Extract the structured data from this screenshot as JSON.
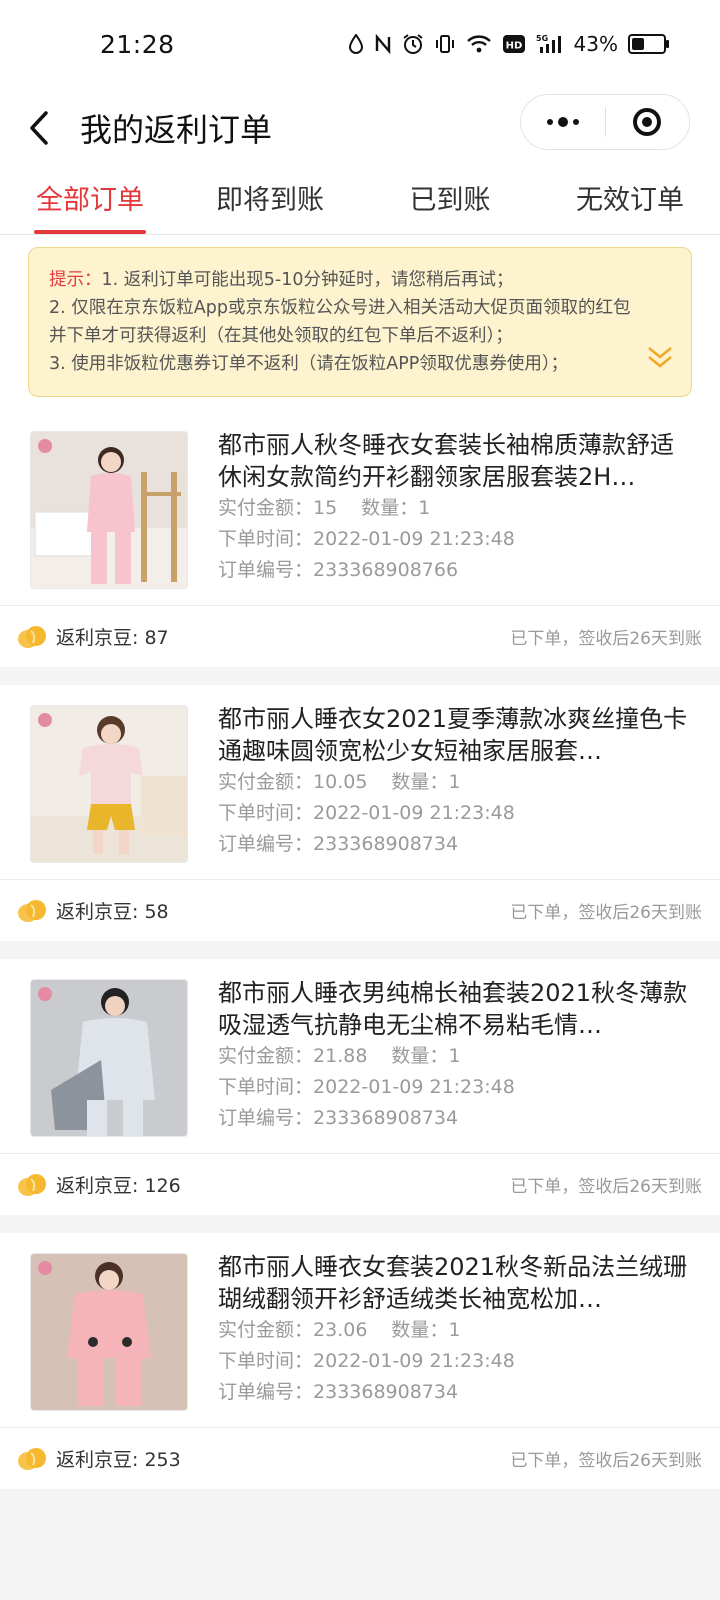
{
  "status_bar": {
    "time": "21:28",
    "icons": [
      "water-drop-icon",
      "nfc-icon",
      "alarm-icon",
      "vibrate-icon",
      "wifi-icon",
      "hd-icon",
      "signal-5g-icon"
    ],
    "battery_text": "43%",
    "battery_level": 0.43
  },
  "nav": {
    "title": "我的返利订单"
  },
  "tabs": [
    {
      "label": "全部订单",
      "active": true
    },
    {
      "label": "即将到账",
      "active": false
    },
    {
      "label": "已到账",
      "active": false
    },
    {
      "label": "无效订单",
      "active": false
    }
  ],
  "notice": {
    "hint_label": "提示：",
    "line1": "1. 返利订单可能出现5-10分钟延时，请您稍后再试；",
    "line2": "2. 仅限在京东饭粒App或京东饭粒公众号进入相关活动大促页面领取的红包并下单才可获得返利（在其他处领取的红包下单后不返利）；",
    "line3": "3. 使用非饭粒优惠券订单不返利（请在饭粒APP领取优惠券使用）；"
  },
  "labels": {
    "paid": "实付金额：",
    "qty": "数量：",
    "time": "下单时间：",
    "order_no": "订单编号："
  },
  "orders": [
    {
      "title": "都市丽人秋冬睡衣女套装长袖棉质薄款舒适休闲女款简约开衫翻领家居服套装2H…",
      "paid": "15",
      "qty": "1",
      "time": "2022-01-09 21:23:48",
      "order_no": "233368908766",
      "bean": "返利京豆: 87",
      "status": "已下单，签收后26天到账"
    },
    {
      "title": "都市丽人睡衣女2021夏季薄款冰爽丝撞色卡通趣味圆领宽松少女短袖家居服套…",
      "paid": "10.05",
      "qty": "1",
      "time": "2022-01-09 21:23:48",
      "order_no": "233368908734",
      "bean": "返利京豆: 58",
      "status": "已下单，签收后26天到账"
    },
    {
      "title": "都市丽人睡衣男纯棉长袖套装2021秋冬薄款吸湿透气抗静电无尘棉不易粘毛情…",
      "paid": "21.88",
      "qty": "1",
      "time": "2022-01-09 21:23:48",
      "order_no": "233368908734",
      "bean": "返利京豆: 126",
      "status": "已下单，签收后26天到账"
    },
    {
      "title": "都市丽人睡衣女套装2021秋冬新品法兰绒珊瑚绒翻领开衫舒适绒类长袖宽松加…",
      "paid": "23.06",
      "qty": "1",
      "time": "2022-01-09 21:23:48",
      "order_no": "233368908734",
      "bean": "返利京豆: 253",
      "status": "已下单，签收后26天到账"
    }
  ],
  "colors": {
    "accent": "#e4393c",
    "notice_bg": "#fdf3cf",
    "notice_border": "#f2d78a",
    "bean_gold": "#f5b82e"
  }
}
